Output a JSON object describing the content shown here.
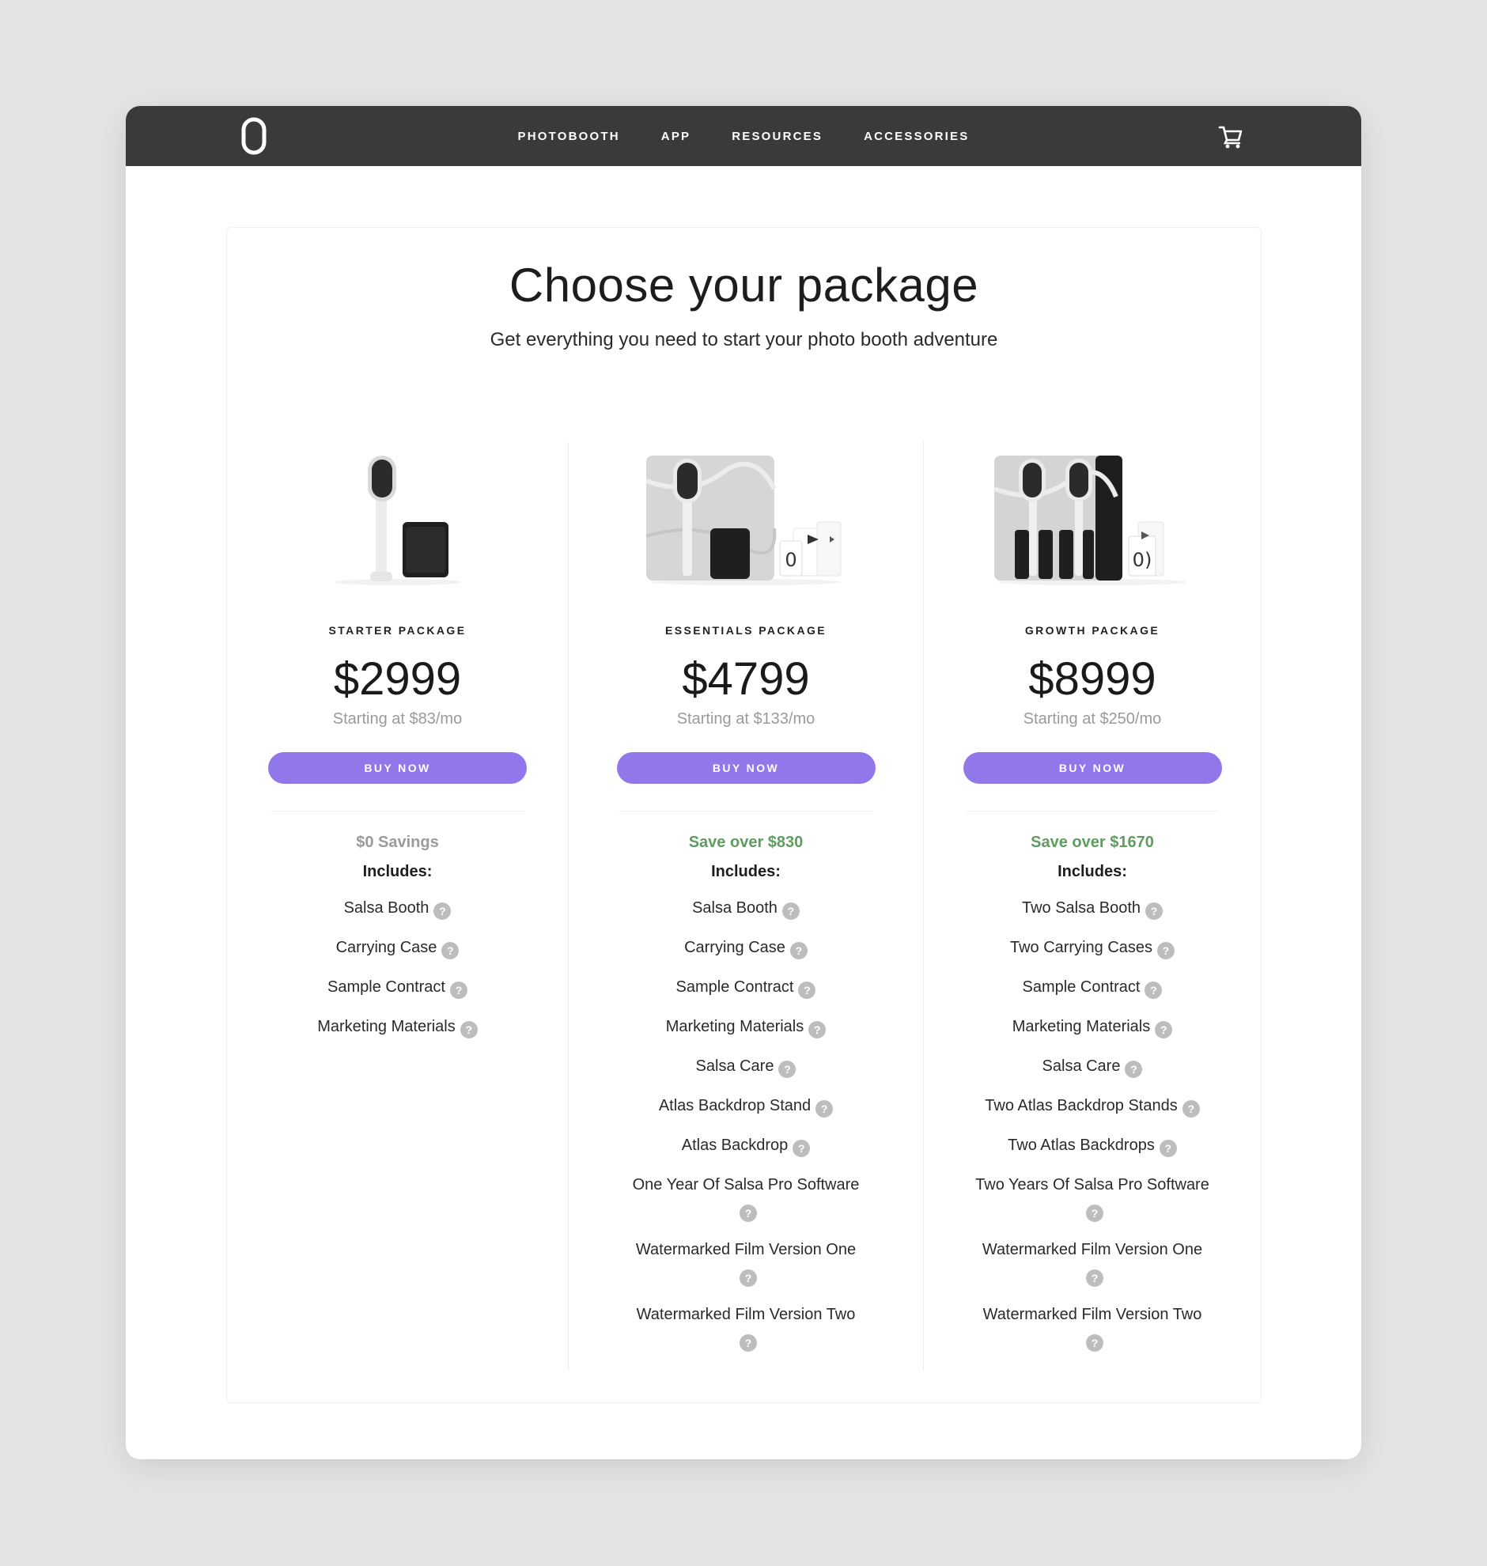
{
  "colors": {
    "accent": "#9277eb",
    "navbar": "#3a3a3a",
    "savings_green": "#5f9c60",
    "muted": "#9b9b9b"
  },
  "nav": {
    "logo_icon": "salsa-logo-icon",
    "links": [
      "PHOTOBOOTH",
      "APP",
      "RESOURCES",
      "ACCESSORIES"
    ],
    "cart_icon": "cart-icon"
  },
  "header": {
    "title": "Choose your package",
    "subtitle": "Get everything you need to start your photo booth adventure"
  },
  "packages": [
    {
      "name": "STARTER PACKAGE",
      "price": "$2999",
      "monthly": "Starting at $83/mo",
      "buy_label": "BUY NOW",
      "savings": "$0 Savings",
      "includes_label": "Includes:",
      "items": [
        "Salsa Booth",
        "Carrying Case",
        "Sample Contract",
        "Marketing Materials"
      ]
    },
    {
      "name": "ESSENTIALS PACKAGE",
      "price": "$4799",
      "monthly": "Starting at $133/mo",
      "buy_label": "BUY NOW",
      "savings": "Save over $830",
      "includes_label": "Includes:",
      "items": [
        "Salsa Booth",
        "Carrying Case",
        "Sample Contract",
        "Marketing Materials",
        "Salsa Care",
        "Atlas Backdrop Stand",
        "Atlas Backdrop",
        "One Year Of Salsa Pro Software",
        "Watermarked Film Version One",
        "Watermarked Film Version Two"
      ]
    },
    {
      "name": "GROWTH PACKAGE",
      "price": "$8999",
      "monthly": "Starting at $250/mo",
      "buy_label": "BUY NOW",
      "savings": "Save over $1670",
      "includes_label": "Includes:",
      "items": [
        "Two Salsa Booth",
        "Two Carrying Cases",
        "Sample Contract",
        "Marketing Materials",
        "Salsa Care",
        "Two Atlas Backdrop Stands",
        "Two Atlas Backdrops",
        "Two Years Of Salsa Pro Software",
        "Watermarked Film Version One",
        "Watermarked Film Version Two"
      ]
    }
  ]
}
